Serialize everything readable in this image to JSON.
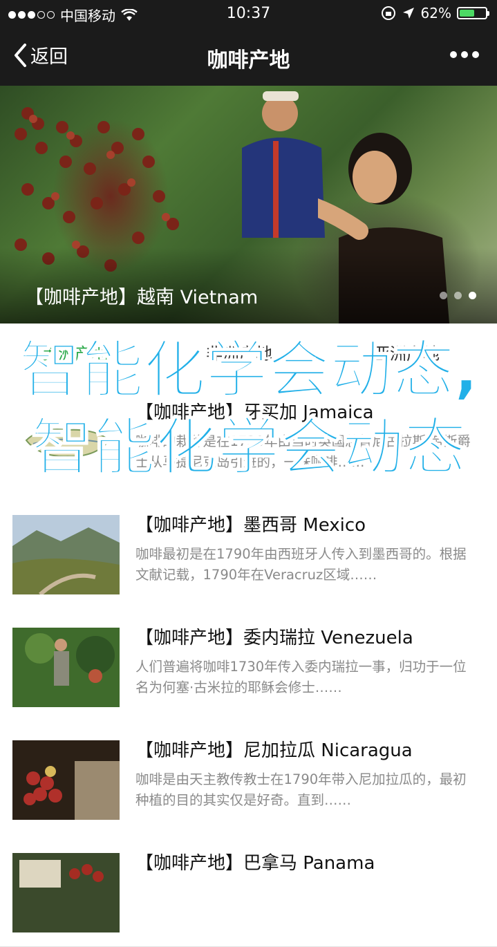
{
  "status_bar": {
    "carrier": "中国移动",
    "time": "10:37",
    "battery_percent": "62%",
    "battery_level": 0.62
  },
  "nav": {
    "back_label": "返回",
    "title": "咖啡产地"
  },
  "hero": {
    "caption": "【咖啡产地】越南 Vietnam",
    "page_count": 3,
    "active_page": 3
  },
  "tabs": [
    "美洲产地",
    "非洲产地",
    "亚洲产地"
  ],
  "list": [
    {
      "title": "【咖啡产地】牙买加 Jamaica",
      "desc": "咖啡的栽种是在1730年由当时英国总督尼古拉斯·劳斯爵士从马提尼克岛引进的，一株咖啡……"
    },
    {
      "title": "【咖啡产地】墨西哥 Mexico",
      "desc": "咖啡最初是在1790年由西班牙人传入到墨西哥的。根据文献记载，1790年在Veracruz区域……"
    },
    {
      "title": "【咖啡产地】委内瑞拉 Venezuela",
      "desc": "人们普遍将咖啡1730年传入委内瑞拉一事，归功于一位名为何塞·古米拉的耶稣会修士……"
    },
    {
      "title": "【咖啡产地】尼加拉瓜 Nicaragua",
      "desc": "咖啡是由天主教传教士在1790年带入尼加拉瓜的，最初种植的目的其实仅是好奇。直到……"
    },
    {
      "title": "【咖啡产地】巴拿马 Panama",
      "desc": ""
    }
  ],
  "overlay_text": "智能化学会动态,智能化学会动态",
  "colors": {
    "accent_green": "#2ba94a",
    "overlay_blue": "#22b0e8",
    "nav_bg": "#1b1b1b"
  }
}
